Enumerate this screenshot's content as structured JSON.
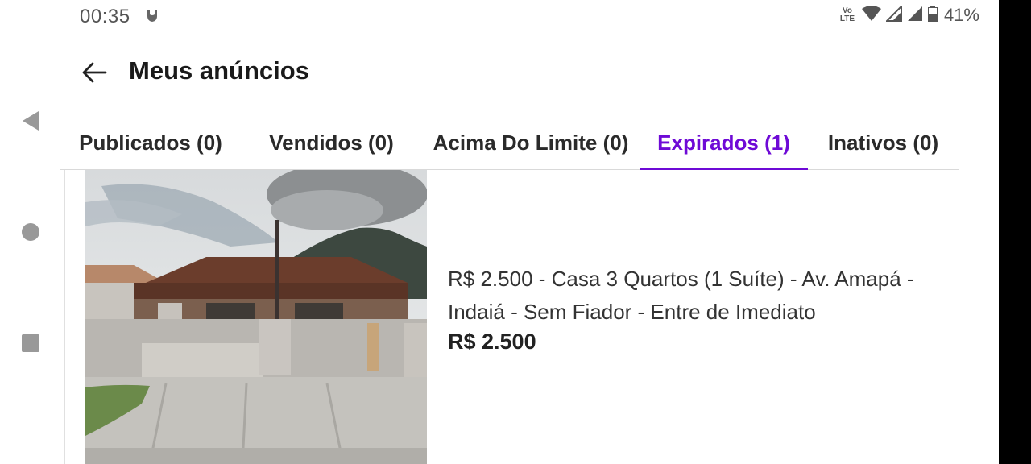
{
  "status_bar": {
    "time": "00:35",
    "volte_top": "Vo",
    "volte_bottom": "LTE",
    "battery": "41%",
    "notif_icon": "shield-notification-icon"
  },
  "app_bar": {
    "title": "Meus anúncios",
    "back_icon": "arrow-left-icon"
  },
  "tabs": [
    {
      "label": "Publicados (0)",
      "active": false
    },
    {
      "label": "Vendidos (0)",
      "active": false
    },
    {
      "label": "Acima Do Limite (0)",
      "active": false
    },
    {
      "label": "Expirados (1)",
      "active": true
    },
    {
      "label": "Inativos (0)",
      "active": false
    }
  ],
  "listing": {
    "title": "R$ 2.500 - Casa 3 Quartos (1 Suíte) - Av. Amapá - Indaiá - Sem Fiador - Entre de Imediato",
    "price": "R$ 2.500",
    "image": "house-photo"
  },
  "system_nav": [
    "back-triangle-icon",
    "home-circle-icon",
    "recents-square-icon"
  ],
  "colors": {
    "accent": "#6e0ad6",
    "text": "#222222"
  }
}
